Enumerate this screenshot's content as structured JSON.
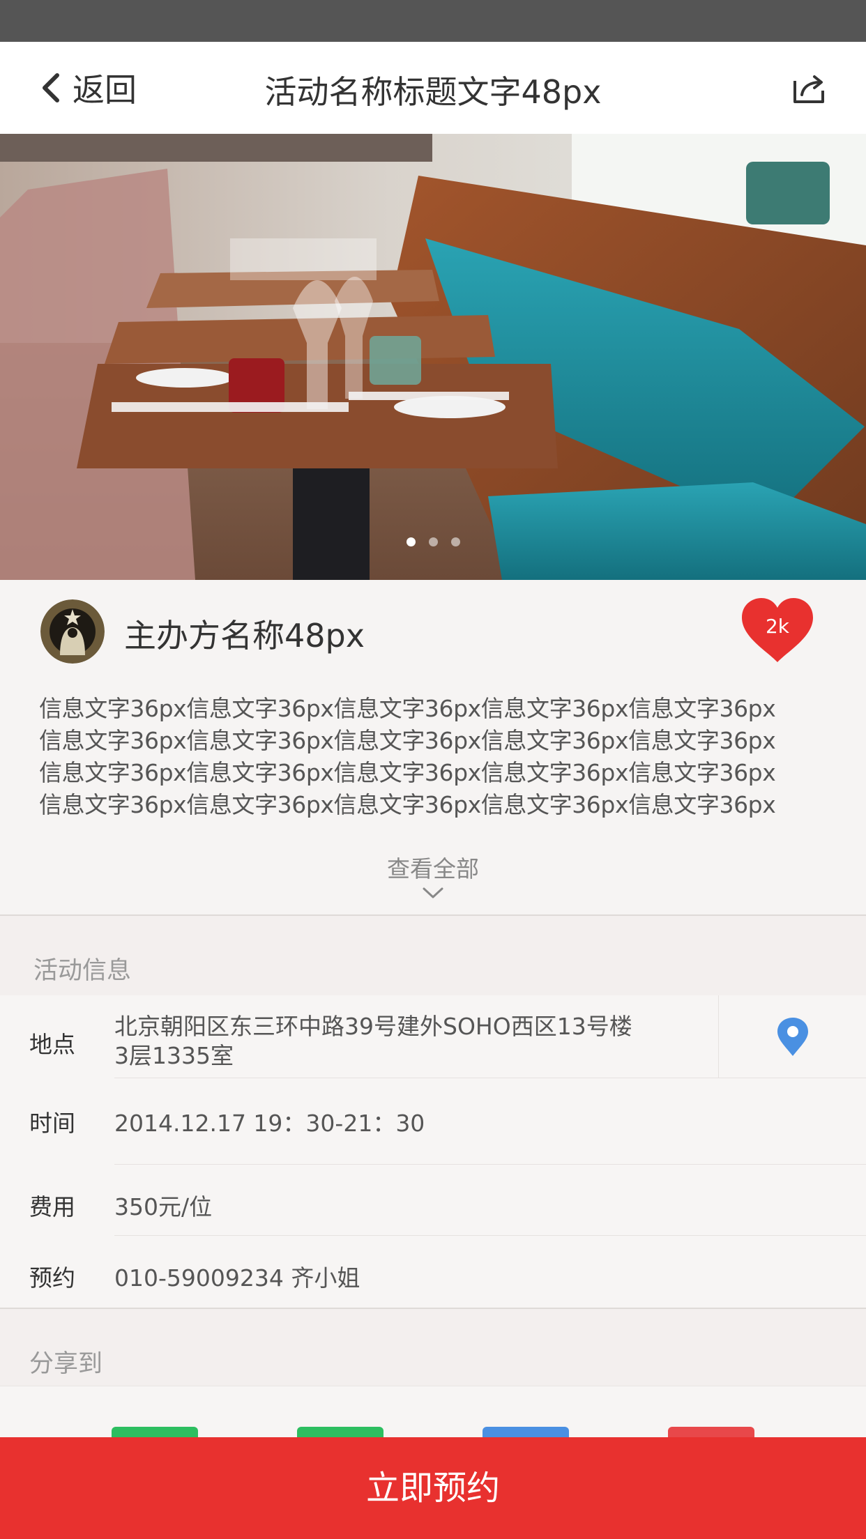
{
  "nav": {
    "back_label": "返回",
    "title": "活动名称标题文字48px",
    "share_icon": "share-icon"
  },
  "banner": {
    "image_icon": "restaurant-photo",
    "slide_count": 3,
    "active_slide": 1
  },
  "organizer": {
    "avatar_icon": "starbucks-logo",
    "name": "主办方名称48px",
    "like_count": "2k",
    "like_color": "#e8312f"
  },
  "description": {
    "lines": [
      "信息文字36px信息文字36px信息文字36px信息文字36px信息文字36px",
      "信息文字36px信息文字36px信息文字36px信息文字36px信息文字36px",
      "信息文字36px信息文字36px信息文字36px信息文字36px信息文字36px",
      "信息文字36px信息文字36px信息文字36px信息文字36px信息文字36px"
    ],
    "view_all_label": "查看全部"
  },
  "info": {
    "section_title": "活动信息",
    "location": {
      "label": "地点",
      "value_line1": "北京朝阳区东三环中路39号建外SOHO西区13号楼",
      "value_line2": "3层1335室",
      "icon": "location-pin-icon",
      "icon_color": "#4a90e2"
    },
    "time": {
      "label": "时间",
      "value": "2014.12.17  19：30-21：30"
    },
    "fee": {
      "label": "费用",
      "value": "350元/位"
    },
    "booking": {
      "label": "预约",
      "value": "010-59009234 齐小姐"
    }
  },
  "share": {
    "section_title": "分享到",
    "targets": [
      {
        "icon": "wechat-icon",
        "color": "#2dbe60"
      },
      {
        "icon": "moments-icon",
        "color": "#2dbe60"
      },
      {
        "icon": "qq-icon",
        "color": "#4a90e2"
      },
      {
        "icon": "weibo-icon",
        "color": "#e8484a"
      }
    ]
  },
  "cta": {
    "label": "立即预约",
    "color": "#e8312f"
  }
}
